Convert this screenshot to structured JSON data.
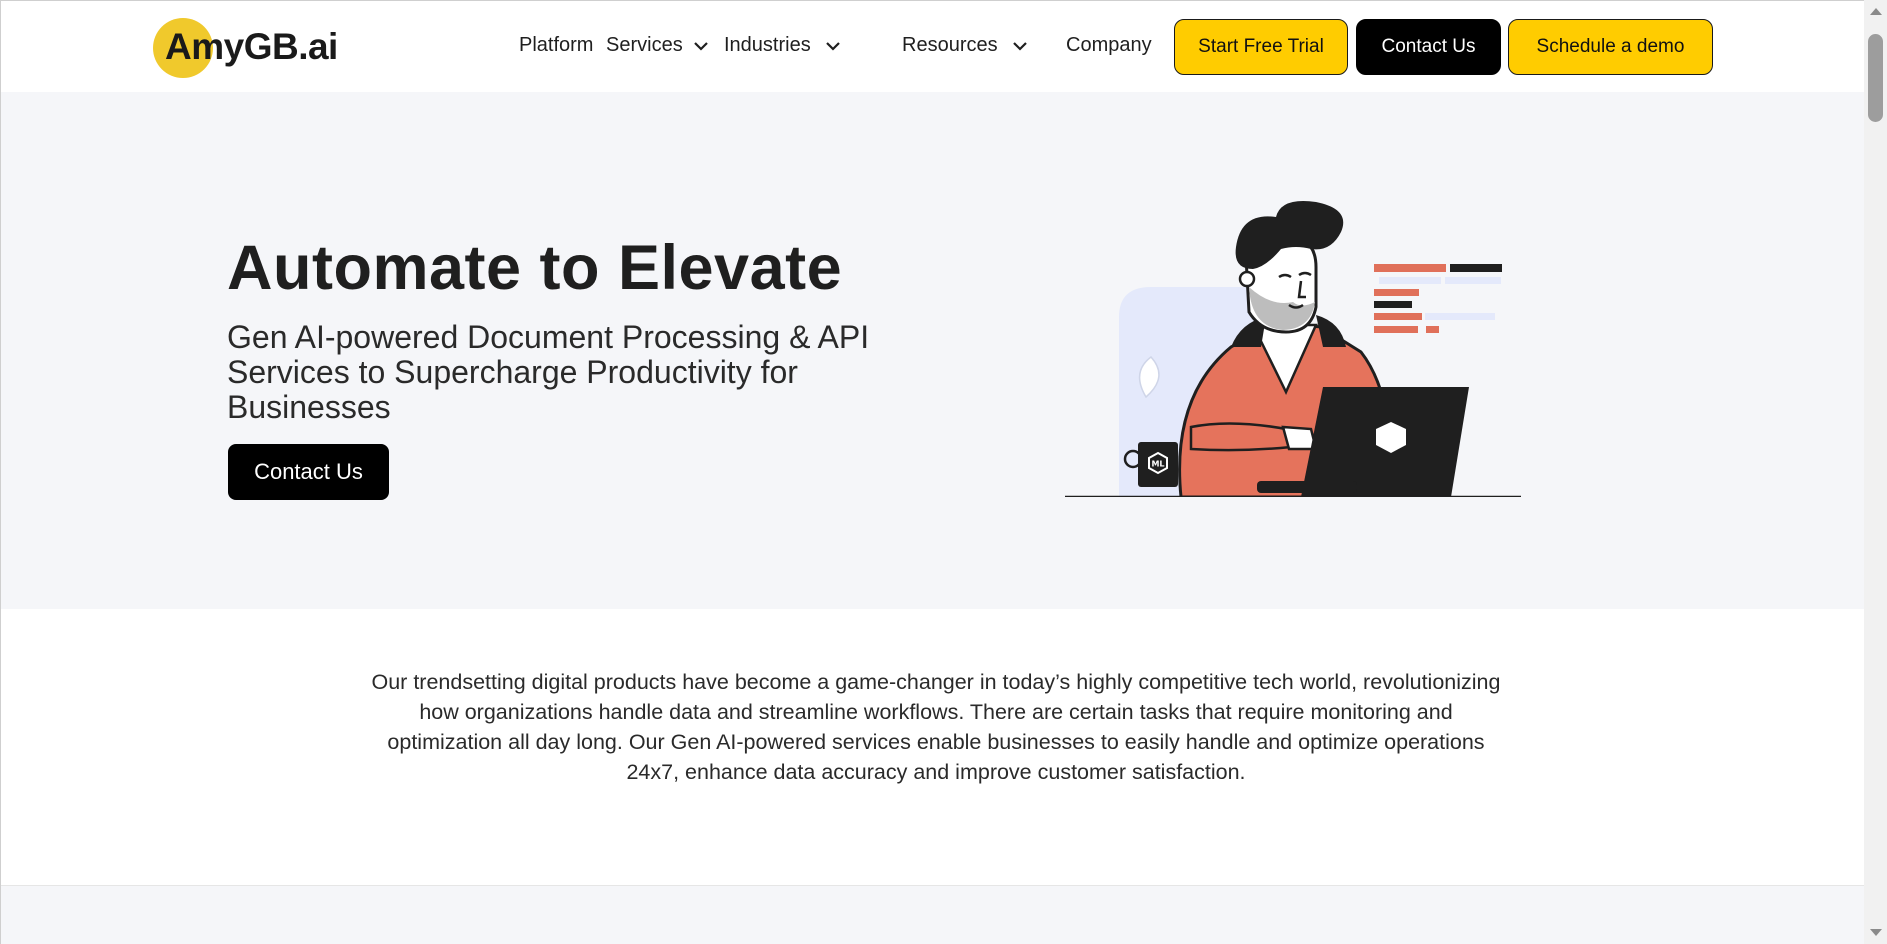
{
  "brand": {
    "logo_text": "AmyGB",
    "logo_tld": ".ai",
    "accent": "#ffcc00"
  },
  "nav": {
    "items": [
      {
        "label": "Platform"
      },
      {
        "label": "Services",
        "has_dropdown": true
      },
      {
        "label": "Industries",
        "has_dropdown": true
      },
      {
        "label": "Resources",
        "has_dropdown": true
      },
      {
        "label": "Company"
      }
    ],
    "buttons": {
      "trial": "Start Free Trial",
      "contact": "Contact Us",
      "demo": "Schedule a demo"
    }
  },
  "hero": {
    "title": "Automate to Elevate",
    "subtitle": "Gen AI-powered Document Processing & API Services to Supercharge Productivity for Businesses",
    "cta": "Contact Us",
    "mug_label": "ML"
  },
  "intro": {
    "text": "Our trendsetting digital products have become a game-changer in today’s highly competitive tech world, revolutionizing how organizations handle data and streamline workflows. There are certain tasks that require monitoring and optimization all day long. Our Gen AI-powered services enable businesses to easily handle and optimize operations 24x7, enhance data accuracy and improve customer satisfaction."
  },
  "icons": {
    "dropdown": "chevron-down-icon",
    "scroll_up": "arrow-up-icon",
    "scroll_down": "arrow-down-icon"
  }
}
